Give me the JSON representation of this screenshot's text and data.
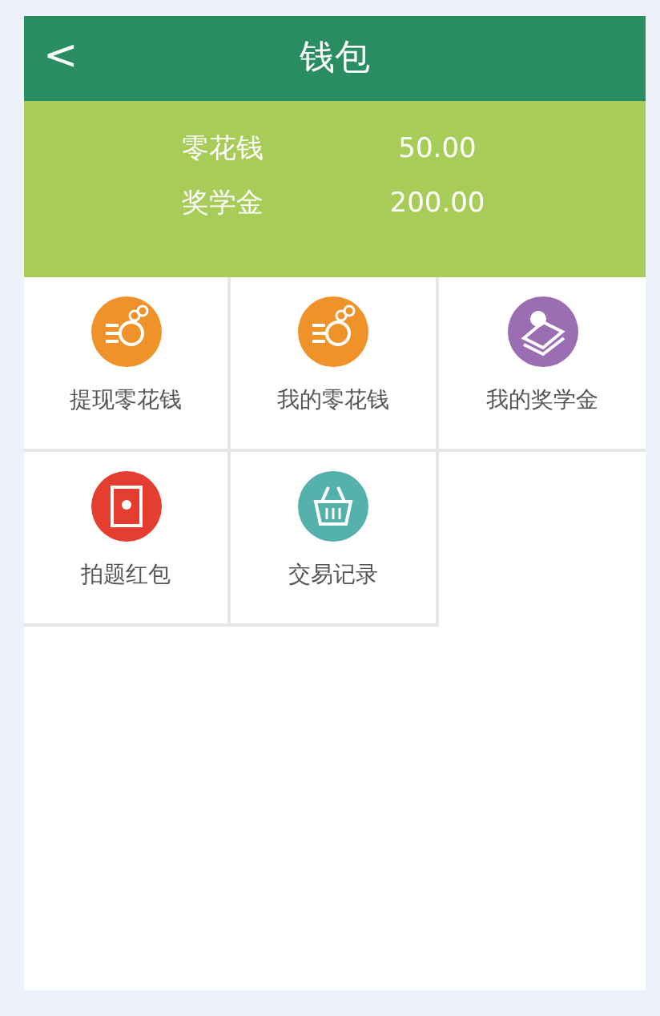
{
  "header": {
    "back_icon": "<",
    "title": "钱包"
  },
  "balances": [
    {
      "label": "零花钱",
      "amount": "50.00"
    },
    {
      "label": "奖学金",
      "amount": "200.00"
    }
  ],
  "menu": [
    {
      "label": "提现零花钱",
      "kind": "coins",
      "color": "#f0922a"
    },
    {
      "label": "我的零花钱",
      "kind": "coins",
      "color": "#f0922a"
    },
    {
      "label": "我的奖学金",
      "kind": "stack",
      "color": "#9b6db3"
    },
    {
      "label": "拍题红包",
      "kind": "envelope",
      "color": "#e53d2f"
    },
    {
      "label": "交易记录",
      "kind": "basket",
      "color": "#55b1ab"
    }
  ]
}
